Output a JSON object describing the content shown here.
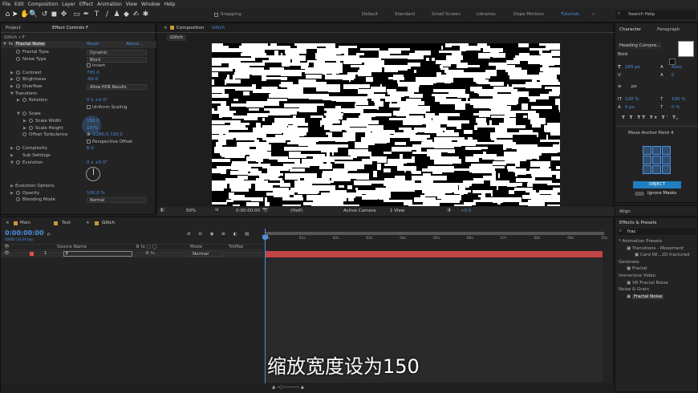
{
  "menu": [
    "File",
    "Edit",
    "Composition",
    "Layer",
    "Effect",
    "Animation",
    "View",
    "Window",
    "Help"
  ],
  "toolbar": {
    "snapping": "Snapping",
    "workspaces": [
      "Default",
      "Standard",
      "Small Screen",
      "Libraries",
      "Dope Motions",
      "Tutorials"
    ],
    "active_workspace": "Tutorials",
    "search": "Search Help"
  },
  "ec": {
    "tab_project": "Project",
    "tab_effect": "Effect Controls F",
    "breadcrumb": "Glitch • F",
    "effect": "Fractal Noise",
    "reset": "Reset",
    "about": "About...",
    "rows": [
      {
        "n": "Fractal Type",
        "v": "Dynamic",
        "t": "dd"
      },
      {
        "n": "Noise Type",
        "v": "Block",
        "t": "dd"
      },
      {
        "n": "",
        "v": "Invert",
        "t": "cb"
      },
      {
        "n": "Contrast",
        "v": "705.0"
      },
      {
        "n": "Brightness",
        "v": "-60.0"
      },
      {
        "n": "Overflow",
        "v": "Allow HDR Results",
        "t": "dd"
      },
      {
        "n": "Transform",
        "v": ""
      },
      {
        "n": "Rotation",
        "v": "0 x +0.0°"
      },
      {
        "n": "",
        "v": "Uniform Scaling",
        "t": "cb"
      },
      {
        "n": "Scale",
        "v": ""
      },
      {
        "n": "Scale Width",
        "v": "150.0"
      },
      {
        "n": "Scale Height",
        "v": "1070"
      },
      {
        "n": "Offset Turbulence",
        "v": "1280.0,720.0"
      },
      {
        "n": "",
        "v": "Perspective Offset",
        "t": "cb"
      },
      {
        "n": "Complexity",
        "v": "6.0"
      },
      {
        "n": "Sub Settings",
        "v": ""
      },
      {
        "n": "Evolution",
        "v": "0 x +0.0°"
      }
    ],
    "evo_options": "Evolution Options",
    "opacity": "Opacity",
    "opacity_v": "100.0 %",
    "blend": "Blending Mode",
    "blend_v": "Normal"
  },
  "comp": {
    "tab": "Composition",
    "comp_name": "Glitch",
    "sub": "Glitch",
    "zoom": "50%",
    "time": "0:00:00:00",
    "res": "(Half)",
    "camera": "Active Camera",
    "view": "1 View",
    "exposure": "+0.0"
  },
  "tl": {
    "tabs": [
      "Main",
      "Text",
      "Glitch"
    ],
    "time": "0:00:00:00",
    "fps": "00000 (30.00 fps)",
    "search_placeholder": "ρ.",
    "col_source": "Source Name",
    "col_mode": "Mode",
    "col_trk": "TrkMat",
    "layer_num": "1",
    "layer_name": "F",
    "layer_mode": "Normal",
    "ticks": [
      "0s",
      "01s",
      "02s",
      "03s",
      "04s",
      "05s",
      "06s",
      "07s",
      "08s",
      "09s",
      "10s"
    ]
  },
  "subtitle": "缩放宽度设为150",
  "char": {
    "tab1": "Character",
    "tab2": "Paragraph",
    "font": "Heading Compre...",
    "style": "Bold",
    "size": "165 px",
    "leading": "Auto",
    "tracking": "0",
    "unit": "px",
    "vscale": "100 %",
    "hscale": "100 %",
    "baseline": "0 px",
    "tsume": "0 %"
  },
  "anchor": {
    "title": "Move Anchor Point 4",
    "object": "OBJECT",
    "ignore": "Ignore Masks"
  },
  "align": {
    "tab": "Align"
  },
  "fx": {
    "tab": "Effects & Presets",
    "search": "frac",
    "items": [
      {
        "l": "* Animation Presets",
        "d": 0
      },
      {
        "l": "Transitions - Movement",
        "d": 1
      },
      {
        "l": "Card Wi...2D fractured",
        "d": 2
      },
      {
        "l": "Generate",
        "d": 0
      },
      {
        "l": "Fractal",
        "d": 1
      },
      {
        "l": "Immersive Video",
        "d": 0
      },
      {
        "l": "VR Fractal Noise",
        "d": 1
      },
      {
        "l": "Noise & Grain",
        "d": 0
      },
      {
        "l": "Fractal Noise",
        "d": 1
      }
    ]
  }
}
